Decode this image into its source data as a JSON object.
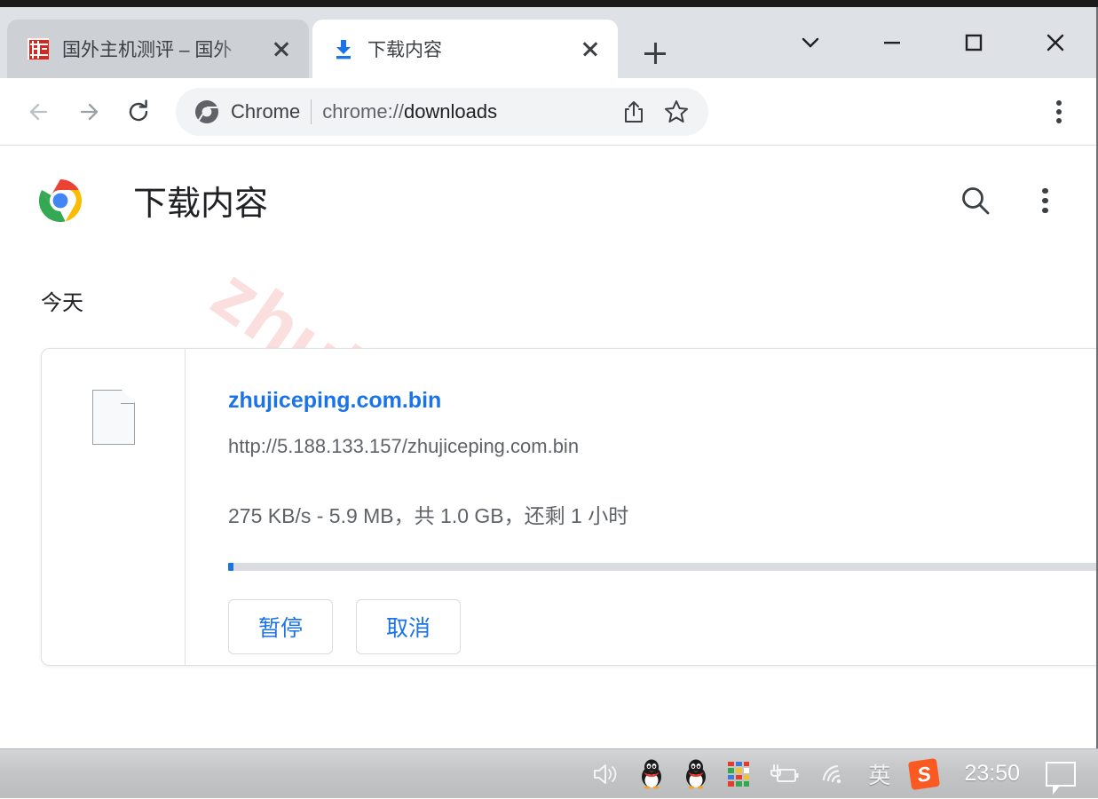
{
  "window": {
    "behind_window_strip_text": "",
    "controls": [
      {
        "name": "tab-search",
        "glyph": "chevron-down"
      },
      {
        "name": "minimize",
        "glyph": "minus"
      },
      {
        "name": "maximize",
        "glyph": "square"
      },
      {
        "name": "close",
        "glyph": "x"
      }
    ]
  },
  "tabs": [
    {
      "title": "国外主机测评 – 国外",
      "favicon": "red-seal-favicon",
      "active": false,
      "close_label": "×"
    },
    {
      "title": "下载内容",
      "favicon": "download-icon",
      "active": true,
      "close_label": "×"
    }
  ],
  "new_tab_label": "+",
  "toolbar": {
    "back_label": "后退",
    "forward_label": "前进",
    "reload_label": "重新加载",
    "omnibox": {
      "chrome_label": "Chrome",
      "url_prefix": "chrome://",
      "url_path": "downloads",
      "full_url": "chrome://downloads",
      "share_label": "分享",
      "bookmark_label": "收藏"
    },
    "menu_label": "自定义及控制"
  },
  "page": {
    "title": "下载内容",
    "logo": "chrome-logo",
    "search_label": "搜索下载内容",
    "more_label": "更多操作",
    "watermark": "zhujiceping.com",
    "date_group": "今天",
    "download": {
      "file_name": "zhujiceping.com.bin",
      "url": "http://5.188.133.157/zhujiceping.com.bin",
      "status": "275 KB/s - 5.9 MB，共 1.0 GB，还剩 1 小时",
      "speed": "275 KB/s",
      "downloaded": "5.9 MB",
      "total_size": "1.0 GB",
      "time_remaining": "1 小时",
      "progress_percent": 0.6,
      "file_icon": "generic-file-icon",
      "buttons": [
        {
          "label": "暂停",
          "name": "pause-button"
        },
        {
          "label": "取消",
          "name": "cancel-button"
        }
      ]
    }
  },
  "taskbar": {
    "clock": "23:50",
    "items": [
      {
        "name": "volume-icon",
        "label": "音量"
      },
      {
        "name": "qq-penguin-icon",
        "label": "QQ"
      },
      {
        "name": "qq-penguin-icon-2",
        "label": "QQ"
      },
      {
        "name": "color-grid-icon",
        "label": "应用"
      },
      {
        "name": "battery-plug-icon",
        "label": "电源"
      },
      {
        "name": "wifi-icon",
        "label": "网络"
      },
      {
        "name": "ime-icon",
        "label": "英"
      },
      {
        "name": "sogou-icon",
        "label": "S"
      }
    ],
    "notification_label": "通知"
  },
  "colors": {
    "accent_blue": "#1a73e8",
    "tabstrip_bg": "#dee1e6",
    "inactive_tab_bg": "#cdd1d6",
    "omnibox_bg": "#f1f3f4",
    "watermark_pink": "#fbdede",
    "taskbar_grey": "#c3c4c6",
    "text_primary": "#202124",
    "text_secondary": "#5f6368"
  }
}
